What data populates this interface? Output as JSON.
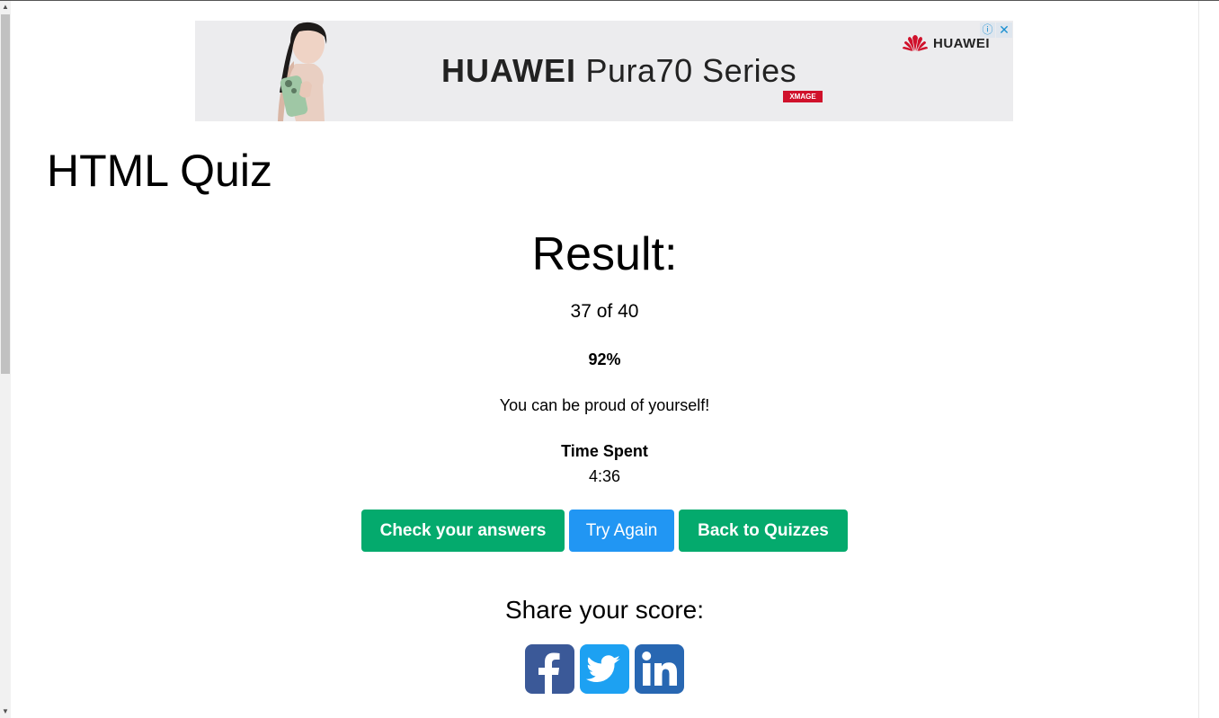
{
  "ad": {
    "brand": "HUAWEI",
    "product": "Pura70 Series",
    "badge": "XMAGE",
    "logo_text": "HUAWEI",
    "info_icon": "info-icon",
    "close_icon": "close-icon",
    "accent_color": "#d0112b"
  },
  "page": {
    "title": "HTML Quiz"
  },
  "result": {
    "heading": "Result:",
    "score": "37 of 40",
    "percent": "92%",
    "message": "You can be proud of yourself!",
    "time_label": "Time Spent",
    "time_value": "4:36"
  },
  "buttons": {
    "check": "Check your answers",
    "try_again": "Try Again",
    "back": "Back to Quizzes",
    "green_color": "#04aa6d",
    "blue_color": "#2196f3"
  },
  "share": {
    "heading": "Share your score:",
    "icons": [
      "facebook-icon",
      "twitter-icon",
      "linkedin-icon"
    ]
  }
}
